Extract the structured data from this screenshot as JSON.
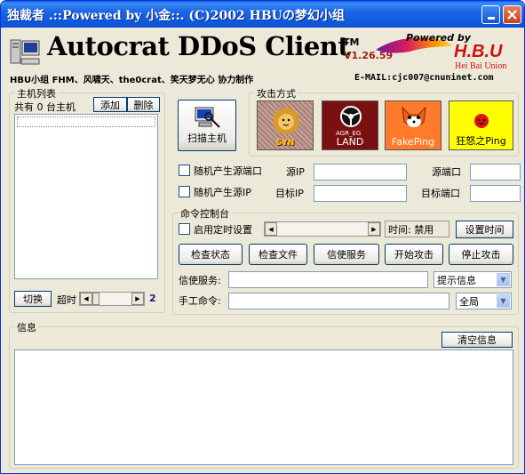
{
  "window": {
    "title": "独裁者 .::Powered by 小金::. (C)2002 HBUの梦幻小组"
  },
  "header": {
    "app_title": "Autocrat DDoS Client",
    "trademark": "TM",
    "version": "V1.26.59",
    "powered_by": "Powered by",
    "brand": "H.B.U",
    "brand_sub": "Hei Bai Union",
    "credits": "HBU小组 FHM、风啸天、the0crat、笑天梦无心 协力制作",
    "email": "E-MAIL:cjc007@cnuninet.com"
  },
  "host_list": {
    "group_label": "主机列表",
    "count_text": "共有 0 台主机",
    "add_label": "添加",
    "delete_label": "删除",
    "switch_label": "切换",
    "timeout_label": "超时",
    "timeout_value": "2",
    "timeout_fraction": 0.0
  },
  "scan": {
    "label": "扫描主机"
  },
  "attack_modes": {
    "group_label": "攻击方式",
    "items": [
      {
        "label": "SYN",
        "color": "#c39a8a"
      },
      {
        "label": "LAND",
        "color": "#7a1010",
        "sublabel": "AGR_EG"
      },
      {
        "label": "FakePing",
        "color": "#ff7a2a"
      },
      {
        "label": "狂怒之Ping",
        "color": "#ffff00"
      }
    ]
  },
  "source": {
    "random_port_label": "随机产生源端口",
    "random_ip_label": "随机产生源IP",
    "source_ip_label": "源IP",
    "source_port_label": "源端口",
    "target_ip_label": "目标IP",
    "target_port_label": "目标端口",
    "source_ip_value": "",
    "source_port_value": "",
    "target_ip_value": "",
    "target_port_value": ""
  },
  "console": {
    "group_label": "命令控制台",
    "timer_label": "启用定时设置",
    "time_text": "时间: 禁用",
    "set_time_label": "设置时间",
    "check_status_label": "检查状态",
    "check_file_label": "检查文件",
    "messenger_label": "信使服务",
    "start_attack_label": "开始攻击",
    "stop_attack_label": "停止攻击",
    "messenger_service_label": "信使服务:",
    "messenger_select": "提示信息",
    "manual_cmd_label": "手工命令:",
    "manual_select": "全局",
    "messenger_value": "",
    "manual_value": ""
  },
  "info": {
    "group_label": "信息",
    "clear_label": "清空信息",
    "content": ""
  }
}
